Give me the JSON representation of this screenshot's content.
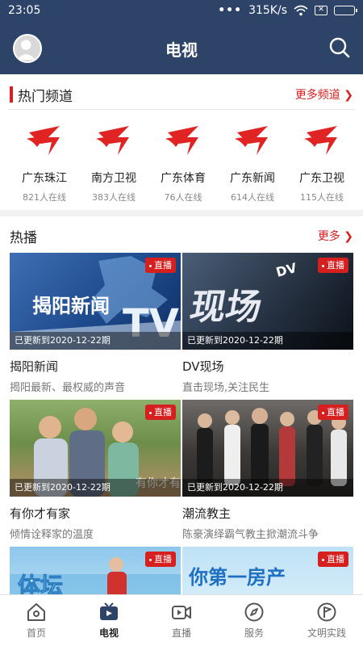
{
  "status_bar": {
    "time": "23:05",
    "signal_dots": "•••",
    "net_speed": "315K/s"
  },
  "header": {
    "title": "电视"
  },
  "hot_channels": {
    "title": "热门频道",
    "more": "更多频道 ❯",
    "items": [
      {
        "name": "广东珠江",
        "online": "821人在线"
      },
      {
        "name": "南方卫视",
        "online": "383人在线"
      },
      {
        "name": "广东体育",
        "online": "76人在线"
      },
      {
        "name": "广东新闻",
        "online": "614人在线"
      },
      {
        "name": "广东卫视",
        "online": "115人在线"
      }
    ]
  },
  "hot_broadcast": {
    "title": "热播",
    "more": "更多 ❯",
    "live_label": "直播",
    "items": [
      {
        "title": "揭阳新闻",
        "subtitle": "揭阳最新、最权威的声音",
        "update": "已更新到2020-12-22期"
      },
      {
        "title": "DV现场",
        "subtitle": "直击现场,关注民生",
        "update": "已更新到2020-12-22期"
      },
      {
        "title": "有你才有家",
        "subtitle": "倾情诠释家的温度",
        "update": "已更新到2020-12-22期"
      },
      {
        "title": "潮流教主",
        "subtitle": "陈豪演绎霸气教主掀潮流斗争",
        "update": "已更新到2020-12-22期"
      },
      {
        "title": "",
        "subtitle": "",
        "update": ""
      },
      {
        "title": "",
        "subtitle": "",
        "update": ""
      }
    ]
  },
  "tabbar": {
    "items": [
      {
        "label": "首页",
        "icon": "home-icon"
      },
      {
        "label": "电视",
        "icon": "tv-icon",
        "active": true
      },
      {
        "label": "直播",
        "icon": "video-icon"
      },
      {
        "label": "服务",
        "icon": "compass-icon"
      },
      {
        "label": "文明实践",
        "icon": "flag-circle-icon"
      }
    ]
  },
  "colors": {
    "header_bg": "#2d4468",
    "accent_red": "#d61f1f"
  }
}
